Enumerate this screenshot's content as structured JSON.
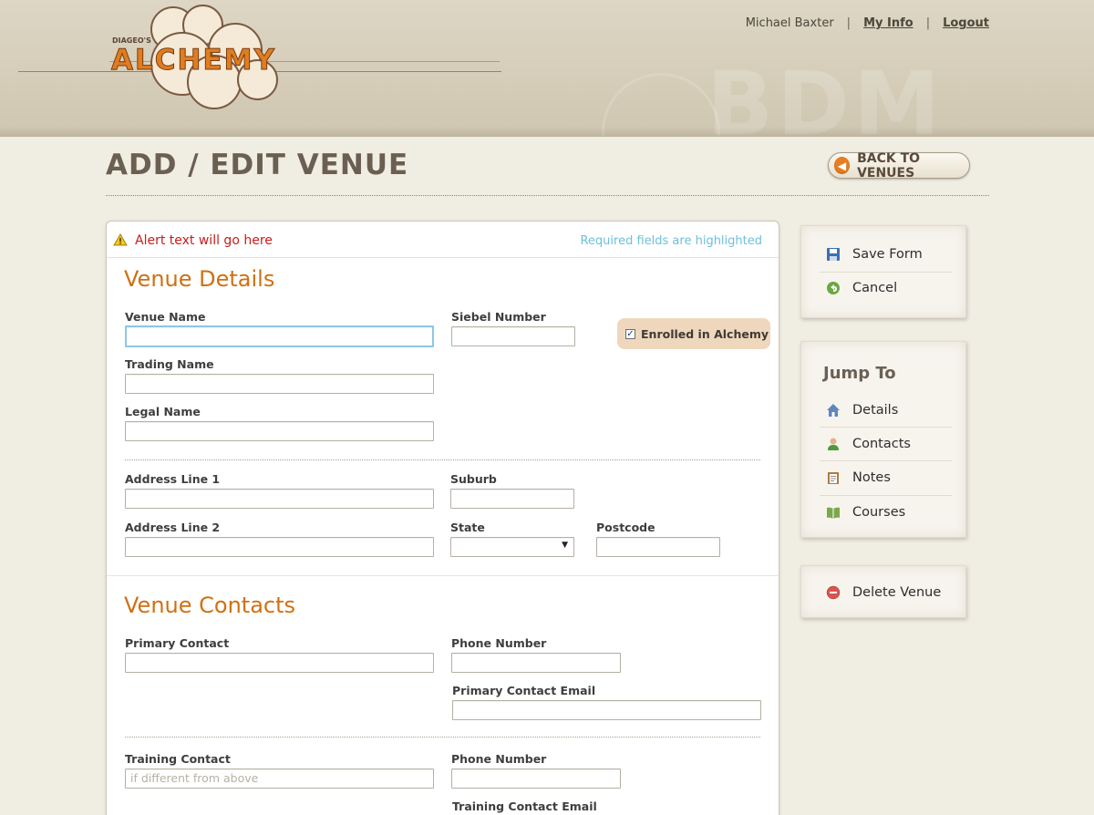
{
  "header": {
    "brand_small": "DIAGEO'S",
    "brand_name": "ALCHEMY",
    "watermark": "BDM",
    "user_name": "Michael Baxter",
    "separator": "|",
    "my_info": "My Info",
    "logout": "Logout"
  },
  "page": {
    "title": "ADD / EDIT VENUE",
    "back_button": "BACK TO VENUES"
  },
  "alert": {
    "text": "Alert text will go here",
    "required_note": "Required fields are highlighted"
  },
  "venue_details": {
    "title": "Venue Details",
    "venue_name_label": "Venue Name",
    "venue_name_value": "",
    "siebel_label": "Siebel Number",
    "siebel_value": "",
    "enrolled_label": "Enrolled in Alchemy",
    "enrolled_checked": true,
    "trading_name_label": "Trading Name",
    "legal_name_label": "Legal Name",
    "address1_label": "Address Line 1",
    "suburb_label": "Suburb",
    "address2_label": "Address Line 2",
    "state_label": "State",
    "state_value": "",
    "postcode_label": "Postcode"
  },
  "venue_contacts": {
    "title": "Venue Contacts",
    "primary_contact_label": "Primary Contact",
    "phone_label": "Phone Number",
    "primary_email_label": "Primary Contact Email",
    "training_contact_label": "Training Contact",
    "training_placeholder": "if different from above",
    "training_phone_label": "Phone Number",
    "training_email_label": "Training Contact Email"
  },
  "actions": {
    "save": "Save Form",
    "cancel": "Cancel"
  },
  "jump_to": {
    "title": "Jump To",
    "items": [
      {
        "label": "Details",
        "icon": "home-icon"
      },
      {
        "label": "Contacts",
        "icon": "person-icon"
      },
      {
        "label": "Notes",
        "icon": "clipboard-icon"
      },
      {
        "label": "Courses",
        "icon": "book-icon"
      }
    ]
  },
  "danger": {
    "delete": "Delete Venue"
  },
  "colors": {
    "accent_orange": "#d07012",
    "alert_red": "#cc1a1a",
    "info_blue": "#6ec0dc",
    "enrolled_bg": "#efd7bd"
  }
}
